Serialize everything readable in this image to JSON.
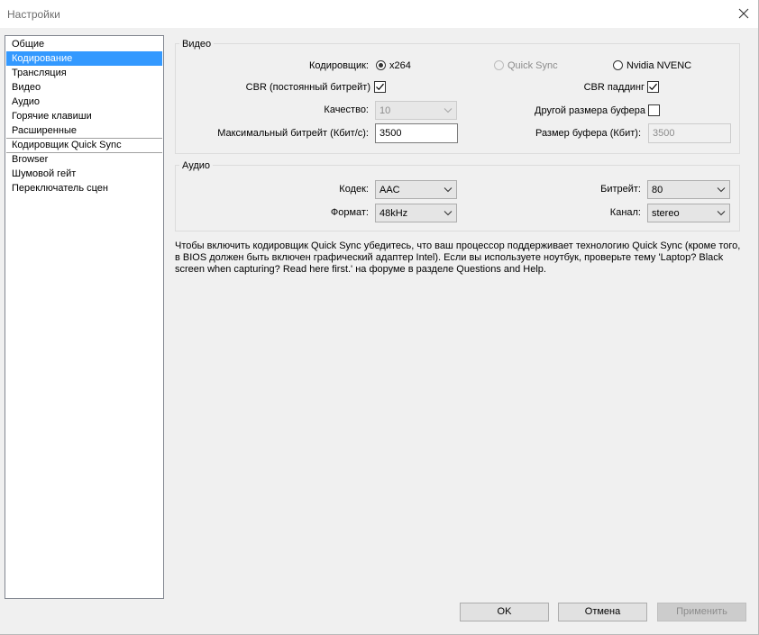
{
  "window": {
    "title": "Настройки"
  },
  "nav": {
    "items": [
      {
        "label": "Общие"
      },
      {
        "label": "Кодирование",
        "selected": true
      },
      {
        "label": "Трансляция"
      },
      {
        "label": "Видео"
      },
      {
        "label": "Аудио"
      },
      {
        "label": "Горячие клавиши"
      },
      {
        "label": "Расширенные"
      },
      {
        "label": "Кодировщик Quick Sync"
      },
      {
        "label": "Browser"
      },
      {
        "label": "Шумовой гейт"
      },
      {
        "label": "Переключатель сцен"
      }
    ]
  },
  "video": {
    "group_title": "Видео",
    "encoder_label": "Кодировщик:",
    "encoder_options": [
      {
        "label": "x264",
        "checked": true,
        "enabled": true
      },
      {
        "label": "Quick Sync",
        "checked": false,
        "enabled": false
      },
      {
        "label": "Nvidia NVENC",
        "checked": false,
        "enabled": true
      }
    ],
    "cbr_label": "CBR (постоянный битрейт)",
    "cbr_checked": true,
    "cbr_padding_label": "CBR паддинг",
    "cbr_padding_checked": true,
    "quality_label": "Качество:",
    "quality_value": "10",
    "custom_buffer_label": "Другой размера буфера",
    "custom_buffer_checked": false,
    "max_bitrate_label": "Максимальный битрейт (Кбит/с):",
    "max_bitrate_value": "3500",
    "buffer_size_label": "Размер буфера (Кбит):",
    "buffer_size_value": "3500"
  },
  "audio": {
    "group_title": "Аудио",
    "codec_label": "Кодек:",
    "codec_value": "AAC",
    "bitrate_label": "Битрейт:",
    "bitrate_value": "80",
    "format_label": "Формат:",
    "format_value": "48kHz",
    "channel_label": "Канал:",
    "channel_value": "stereo"
  },
  "info_text": "Чтобы включить кодировщик Quick Sync убедитесь, что ваш процессор поддерживает технологию Quick Sync (кроме того, в BIOS должен быть включен графический адаптер Intel). Если вы используете ноутбук, проверьте тему 'Laptop? Black screen when capturing? Read here first.' на форуме в разделе Questions and Help.",
  "buttons": {
    "ok": "OK",
    "cancel": "Отмена",
    "apply": "Применить"
  },
  "icons": {
    "close": "close-icon",
    "checkmark": "checkmark-icon",
    "dropdown": "chevron-down-icon"
  },
  "colors": {
    "selection": "#3399ff",
    "window_bg": "#f0f0f0"
  }
}
